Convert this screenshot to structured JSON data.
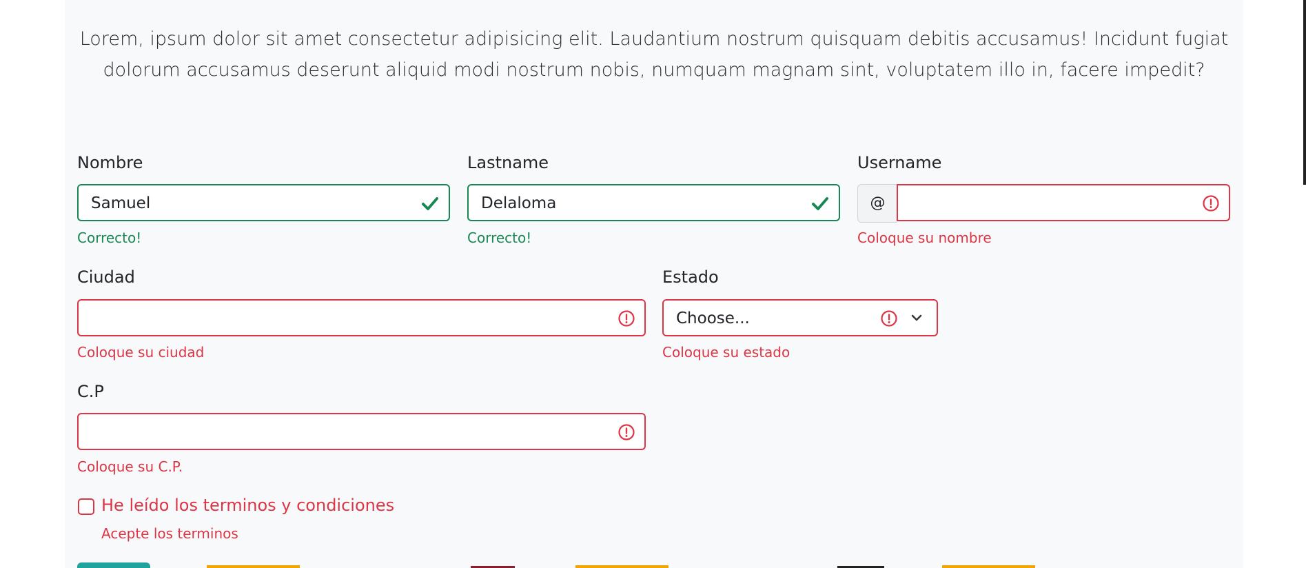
{
  "intro_text": "Lorem, ipsum dolor sit amet consectetur adipisicing elit. Laudantium nostrum quisquam debitis accusamus! Incidunt fugiat dolorum accusamus deserunt aliquid modi nostrum nobis, numquam magnam sint, voluptatem illo in, facere impedit?",
  "form": {
    "nombre": {
      "label": "Nombre",
      "value": "Samuel",
      "feedback": "Correcto!"
    },
    "lastname": {
      "label": "Lastname",
      "value": "Delaloma",
      "feedback": "Correcto!"
    },
    "username": {
      "label": "Username",
      "prefix": "@",
      "value": "",
      "feedback": "Coloque su nombre"
    },
    "ciudad": {
      "label": "Ciudad",
      "value": "",
      "feedback": "Coloque su ciudad"
    },
    "estado": {
      "label": "Estado",
      "selected": "Choose...",
      "feedback": "Coloque su estado"
    },
    "cp": {
      "label": "C.P",
      "value": "",
      "feedback": "Coloque su C.P."
    },
    "terms": {
      "label": "He leído los terminos y condiciones",
      "feedback": "Acepte los terminos",
      "checked": false
    }
  },
  "colors": {
    "valid": "#198754",
    "invalid": "#dc3545",
    "panel": "#f8f9fa"
  }
}
